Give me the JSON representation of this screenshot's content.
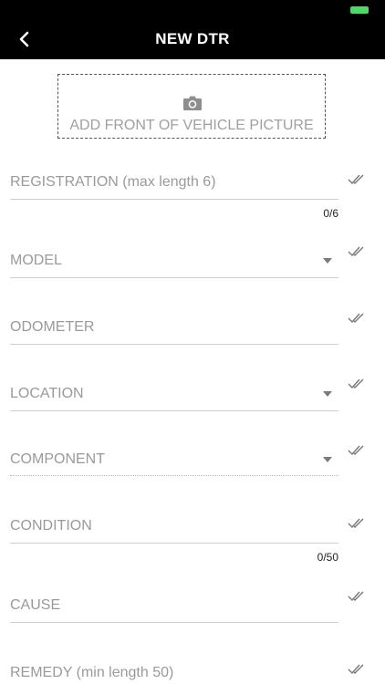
{
  "header": {
    "title": "NEW DTR",
    "back_icon": "chevron-left-icon"
  },
  "photo": {
    "label": "ADD FRONT OF VEHICLE PICTURE",
    "icon": "camera-icon"
  },
  "fields": {
    "registration": {
      "label": "REGISTRATION (max length 6)",
      "counter": "0/6"
    },
    "model": {
      "label": "MODEL"
    },
    "odometer": {
      "label": "ODOMETER"
    },
    "location": {
      "label": "LOCATION"
    },
    "component": {
      "label": "COMPONENT"
    },
    "condition": {
      "label": "CONDITION",
      "counter": "0/50"
    },
    "cause": {
      "label": "CAUSE"
    },
    "remedy": {
      "label": "REMEDY (min length 50)"
    }
  },
  "colors": {
    "battery": "#4cd964",
    "navbar": "#000000",
    "label": "#9a9a9a"
  }
}
